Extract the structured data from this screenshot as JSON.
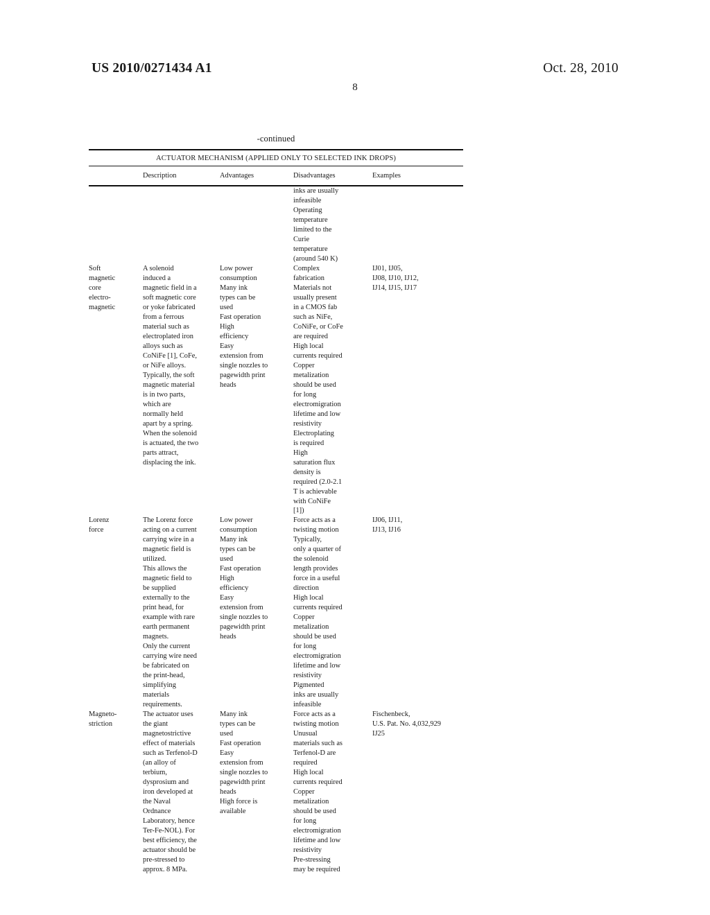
{
  "header": {
    "publication_number": "US 2010/0271434 A1",
    "publication_date": "Oct. 28, 2010",
    "page_number": "8"
  },
  "table": {
    "continued_label": "-continued",
    "caption": "ACTUATOR MECHANISM (APPLIED ONLY TO SELECTED INK DROPS)",
    "columns": [
      {
        "key": "label",
        "header": ""
      },
      {
        "key": "description",
        "header": "Description"
      },
      {
        "key": "advantages",
        "header": "Advantages"
      },
      {
        "key": "disadvantages",
        "header": "Disadvantages"
      },
      {
        "key": "examples",
        "header": "Examples"
      }
    ],
    "rows": [
      {
        "label": "",
        "description": "",
        "advantages": "",
        "disadvantages": "inks are usually\ninfeasible\nOperating\ntemperature\nlimited to the\nCurie\ntemperature\n(around 540 K)",
        "examples": ""
      },
      {
        "label": "Soft\nmagnetic\ncore\nelectro-\nmagnetic",
        "description": "A solenoid\ninduced a\nmagnetic field in a\nsoft magnetic core\nor yoke fabricated\nfrom a ferrous\nmaterial such as\nelectroplated iron\nalloys such as\nCoNiFe [1], CoFe,\nor NiFe alloys.\nTypically, the soft\nmagnetic material\nis in two parts,\nwhich are\nnormally held\napart by a spring.\nWhen the solenoid\nis actuated, the two\nparts attract,\ndisplacing the ink.",
        "advantages": "Low power\nconsumption\nMany ink\ntypes can be\nused\nFast operation\nHigh\nefficiency\nEasy\nextension from\nsingle nozzles to\npagewidth print\nheads",
        "disadvantages": "Complex\nfabrication\nMaterials not\nusually present\nin a CMOS fab\nsuch as NiFe,\nCoNiFe, or CoFe\nare required\nHigh local\ncurrents required\nCopper\nmetalization\nshould be used\nfor long\nelectromigration\nlifetime and low\nresistivity\nElectroplating\nis required\nHigh\nsaturation flux\ndensity is\nrequired (2.0-2.1\nT is achievable\nwith CoNiFe\n[1])",
        "examples": "IJ01, IJ05,\nIJ08, IJ10, IJ12,\nIJ14, IJ15, IJ17"
      },
      {
        "label": "Lorenz\nforce",
        "description": "The Lorenz force\nacting on a current\ncarrying wire in a\nmagnetic field is\nutilized.\nThis allows the\nmagnetic field to\nbe supplied\nexternally to the\nprint head, for\nexample with rare\nearth permanent\nmagnets.\nOnly the current\ncarrying wire need\nbe fabricated on\nthe print-head,\nsimplifying\nmaterials\nrequirements.",
        "advantages": "Low power\nconsumption\nMany ink\ntypes can be\nused\nFast operation\nHigh\nefficiency\nEasy\nextension from\nsingle nozzles to\npagewidth print\nheads",
        "disadvantages": "Force acts as a\ntwisting motion\nTypically,\nonly a quarter of\nthe solenoid\nlength provides\nforce in a useful\ndirection\nHigh local\ncurrents required\nCopper\nmetalization\nshould be used\nfor long\nelectromigration\nlifetime and low\nresistivity\nPigmented\ninks are usually\ninfeasible",
        "examples": "IJ06, IJ11,\nIJ13, IJ16"
      },
      {
        "label": "Magneto-\nstriction",
        "description": "The actuator uses\nthe giant\nmagnetostrictive\neffect of materials\nsuch as Terfenol-D\n(an alloy of\nterbium,\ndysprosium and\niron developed at\nthe Naval\nOrdnance\nLaboratory, hence\nTer-Fe-NOL). For\nbest efficiency, the\nactuator should be\npre-stressed to\napprox. 8 MPa.",
        "advantages": "Many ink\ntypes can be\nused\nFast operation\nEasy\nextension from\nsingle nozzles to\npagewidth print\nheads\nHigh force is\navailable",
        "disadvantages": "Force acts as a\ntwisting motion\nUnusual\nmaterials such as\nTerfenol-D are\nrequired\nHigh local\ncurrents required\nCopper\nmetalization\nshould be used\nfor long\nelectromigration\nlifetime and low\nresistivity\nPre-stressing\nmay be required",
        "examples": "Fischenbeck,\nU.S. Pat. No. 4,032,929\nIJ25"
      }
    ]
  }
}
